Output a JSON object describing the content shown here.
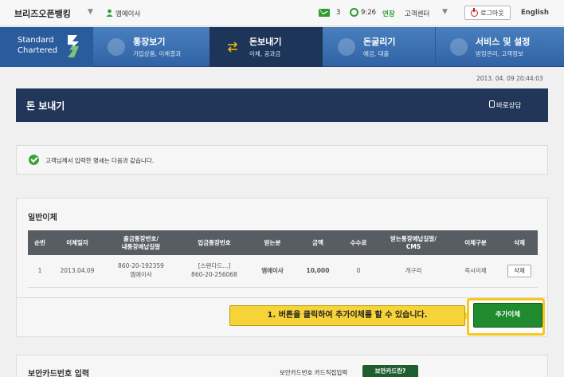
{
  "topbar": {
    "brand": "브리즈오픈뱅킹",
    "user_name": "엠에이사",
    "mail_count": "3",
    "time": "9:26",
    "extend_label": "연장",
    "support_label": "고객센터",
    "logout_label": "로그아웃",
    "language_label": "English"
  },
  "nav": {
    "logo_line1": "Standard",
    "logo_line2": "Chartered",
    "items": [
      {
        "title": "통장보기",
        "subtitle": "가입상품, 이체결과"
      },
      {
        "title": "돈보내기",
        "subtitle": "이체, 공과금"
      },
      {
        "title": "돈굴리기",
        "subtitle": "예금, 대출"
      },
      {
        "title": "서비스 및 설정",
        "subtitle": "방킹관리, 고객정보"
      }
    ]
  },
  "datetime": "2013. 04. 09 20:44:03",
  "page_title": "돈 보내기",
  "consult_label": "바로상담",
  "notice_text": "고객님께서 입력한 명세는 다음과 같습니다.",
  "transfer": {
    "section_title": "일반이체",
    "headers": [
      "순번",
      "이체일자",
      "출금통장번호/\n내통장예납길말",
      "입금통장번호",
      "받는분",
      "금액",
      "수수료",
      "받는통장예납길말/\nCMS",
      "이체구분",
      "삭제"
    ],
    "rows": [
      {
        "no": "1",
        "date": "2013.04.09",
        "from_account": "860-20-192359",
        "from_memo": "엠에이사",
        "to_bank": "[스탠다드...]",
        "to_account": "860-20-256068",
        "payee": "엠에이사",
        "amount": "10,000",
        "fee": "0",
        "to_memo": "개구리",
        "type": "즉시이체",
        "delete_label": "삭제"
      }
    ],
    "tooltip": "1. 버튼을 클릭하여 추가이체를 할 수 있습니다.",
    "add_button": "추가이체"
  },
  "card": {
    "section_title": "보안카드번호 입력",
    "note": "보안카드번호 카드직접입력",
    "button": "보안카드란?"
  },
  "colors": {
    "nav_blue": "#2f63a5",
    "nav_active": "#1d3558",
    "title_bar": "#213659",
    "accent_green": "#1f8a2e",
    "tooltip_yellow": "#f7d33a",
    "amount_red": "#b01010"
  }
}
